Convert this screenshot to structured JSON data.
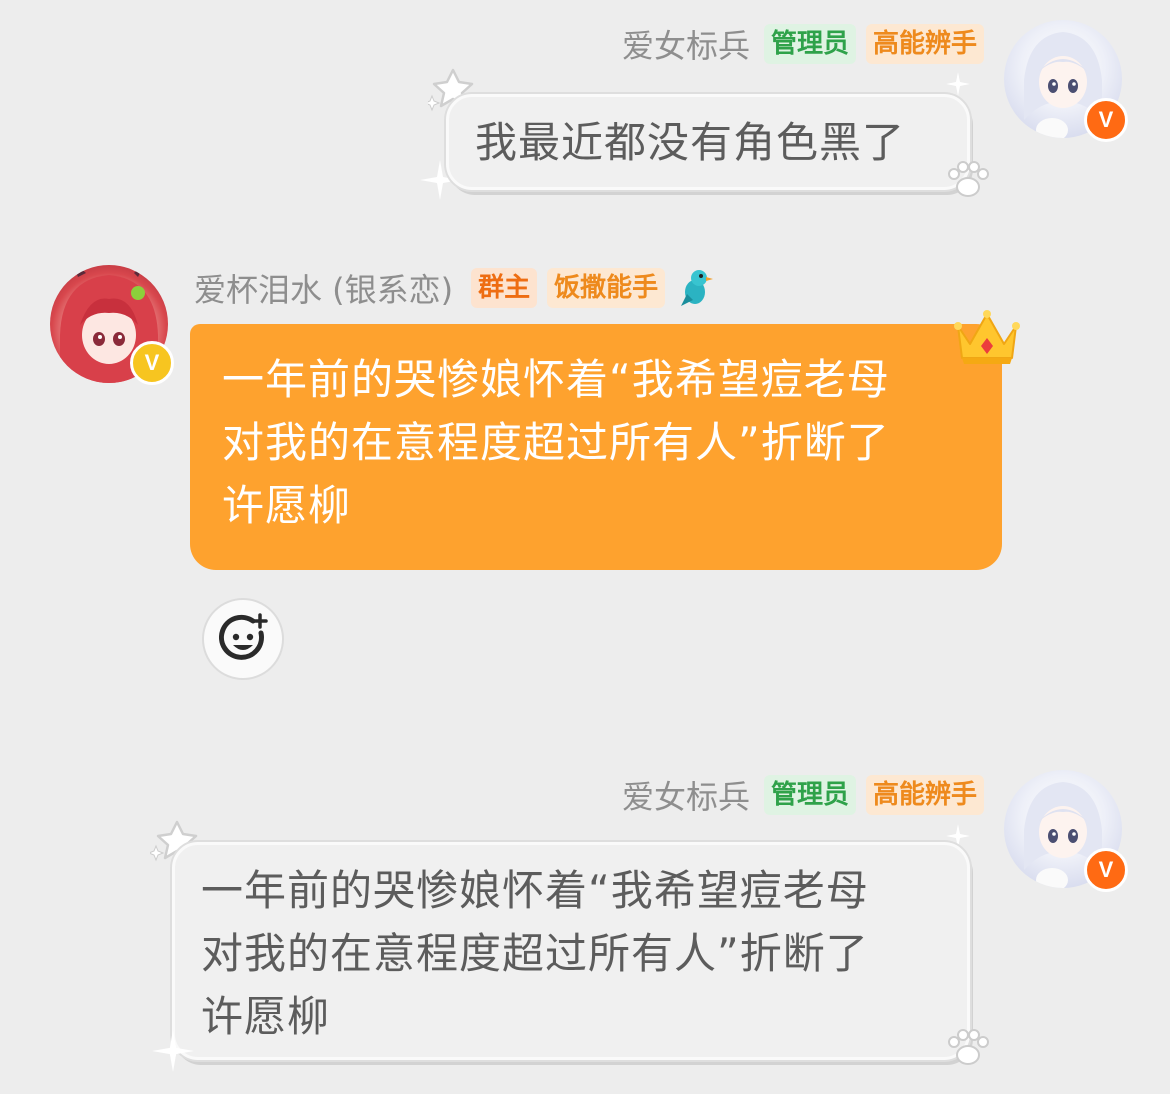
{
  "messages": [
    {
      "side": "right",
      "username": "爱女标兵",
      "badges": [
        "管理员",
        "高能辨手"
      ],
      "text": "我最近都没有角色黑了",
      "avatar_badge": "V"
    },
    {
      "side": "left",
      "username": "爱杯泪水 (银系恋)",
      "badges": [
        "群主",
        "饭撒能手"
      ],
      "text": "一年前的哭惨娘怀着“我希望痘老母\n对我的在意程度超过所有人”折断了\n许愿柳",
      "avatar_badge": "V"
    },
    {
      "side": "right",
      "username": "爱女标兵",
      "badges": [
        "管理员",
        "高能辨手"
      ],
      "text": "一年前的哭惨娘怀着“我希望痘老母\n对我的在意程度超过所有人”折断了\n许愿柳",
      "avatar_badge": "V"
    }
  ],
  "icons": {
    "emoji_add": "add-emoji-icon",
    "crown": "crown-icon",
    "bird": "bird-icon",
    "paw": "paw-icon",
    "star": "star-icon",
    "sparkle": "sparkle-icon"
  },
  "colors": {
    "background": "#ededed",
    "orange_bubble": "#fea22e",
    "gray_bubble": "#f0f0f0",
    "admin_badge_text": "#2fa24a",
    "owner_badge_text": "#ee6d12",
    "verified_orange": "#ff6a13",
    "verified_yellow": "#f7c520"
  }
}
